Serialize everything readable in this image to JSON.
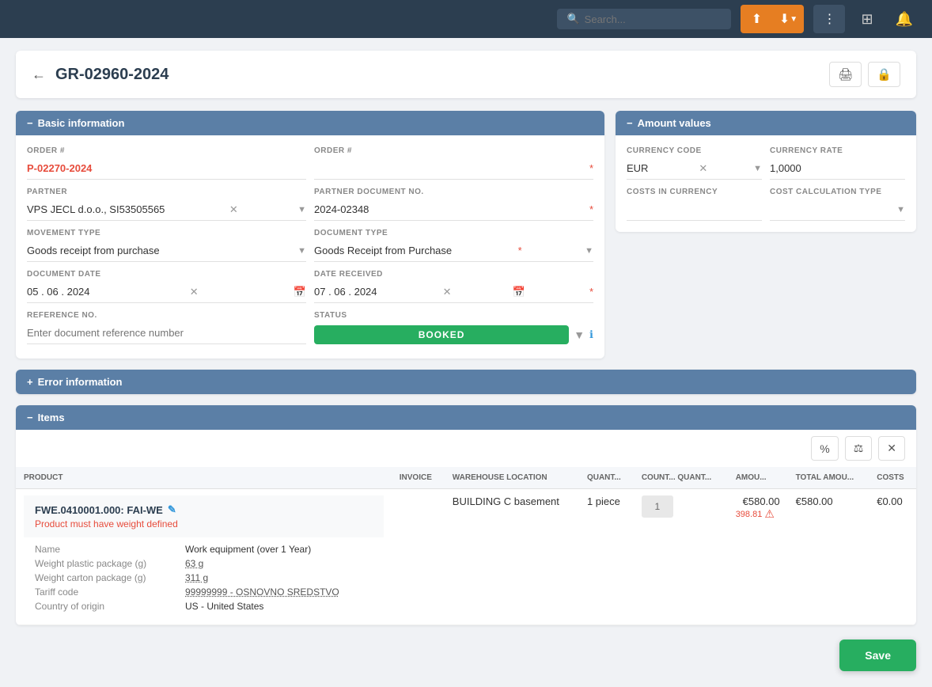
{
  "topnav": {
    "search_placeholder": "Search...",
    "nav_btns": [
      "upload-icon",
      "download-icon",
      "dots-icon",
      "grid-icon",
      "bell-icon"
    ]
  },
  "page": {
    "title": "GR-02960-2024",
    "back_label": "←",
    "print_label": "🖨",
    "lock_label": "🔒"
  },
  "basic_info": {
    "section_label": "Basic information",
    "minus_icon": "−",
    "fields": {
      "order_no_label": "ORDER #",
      "order_no_value": "P-02270-2024",
      "order_no2_label": "ORDER #",
      "order_no2_value": "",
      "partner_label": "PARTNER",
      "partner_value": "VPS JECL d.o.o., SI53505565",
      "partner_doc_label": "PARTNER DOCUMENT NO.",
      "partner_doc_value": "2024-02348",
      "movement_type_label": "MOVEMENT TYPE",
      "movement_type_value": "Goods receipt from purchase",
      "document_type_label": "DOCUMENT TYPE",
      "document_type_value": "Goods Receipt from Purchase",
      "document_date_label": "DOCUMENT DATE",
      "document_date_value": "05 . 06 . 2024",
      "date_received_label": "DATE RECEIVED",
      "date_received_value": "07 . 06 . 2024",
      "reference_no_label": "REFERENCE NO.",
      "reference_no_placeholder": "Enter document reference number",
      "status_label": "STATUS",
      "status_value": "BOOKED"
    }
  },
  "amount_values": {
    "section_label": "Amount values",
    "minus_icon": "−",
    "currency_code_label": "CURRENCY CODE",
    "currency_code_value": "EUR",
    "currency_rate_label": "CURRENCY RATE",
    "currency_rate_value": "1,0000",
    "costs_in_currency_label": "COSTS IN CURRENCY",
    "costs_in_currency_value": "",
    "cost_calc_type_label": "COST CALCULATION TYPE",
    "cost_calc_type_value": ""
  },
  "error_info": {
    "section_label": "Error information",
    "plus_icon": "+"
  },
  "items": {
    "section_label": "Items",
    "minus_icon": "−",
    "columns": [
      "PRODUCT",
      "INVOICE",
      "WAREHOUSE LOCATION",
      "QUANT...",
      "COUNT... QUANT...",
      "AMOU...",
      "TOTAL AMOU...",
      "COSTS"
    ],
    "product": {
      "code": "FWE.0410001.000: FAI-WE",
      "edit_icon": "✎",
      "error": "Product must have weight defined",
      "details": [
        {
          "label": "Name",
          "value": "Work equipment (over 1 Year)"
        },
        {
          "label": "Weight plastic package (g)",
          "value": "63 g"
        },
        {
          "label": "Weight carton package (g)",
          "value": "311 g"
        },
        {
          "label": "Tariff code",
          "value": "99999999 - OSNOVNO SREDSTVO"
        },
        {
          "label": "Country of origin",
          "value": "US - United States"
        }
      ],
      "invoice": "",
      "warehouse_location": "BUILDING C basement",
      "quantity": "1 piece",
      "count_quantity": "1",
      "amount_main": "€580.00",
      "amount_sub": "398.81",
      "total_amount": "€580.00",
      "costs": "€0.00"
    }
  },
  "save_button": {
    "label": "Save"
  }
}
